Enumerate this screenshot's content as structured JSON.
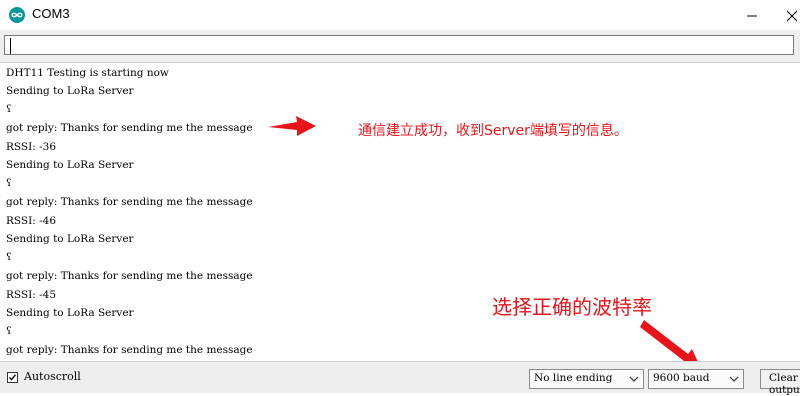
{
  "window": {
    "title": "COM3",
    "icon": "arduino-infinity-icon",
    "accent_color": "#00979c"
  },
  "send_input": {
    "value": ""
  },
  "console": {
    "lines": [
      "DHT11 Testing is starting now",
      "Sending to LoRa Server",
      "ʕ",
      "got reply: Thanks for sending me the message",
      "RSSI: -36",
      "Sending to LoRa Server",
      "ʕ",
      "got reply: Thanks for sending me the message",
      "RSSI: -46",
      "Sending to LoRa Server",
      "ʕ",
      "got reply: Thanks for sending me the message",
      "RSSI: -45",
      "Sending to LoRa Server",
      "ʕ",
      "got reply: Thanks for sending me the message"
    ]
  },
  "annotations": {
    "connection_note": "通信建立成功，收到Server端填写的信息。",
    "baud_note": "选择正确的波特率",
    "color": "#e8141a"
  },
  "statusbar": {
    "autoscroll_label": "Autoscroll",
    "autoscroll_checked": true,
    "line_ending": "No line ending",
    "baud_rate": "9600 baud",
    "clear_label": "Clear output"
  }
}
